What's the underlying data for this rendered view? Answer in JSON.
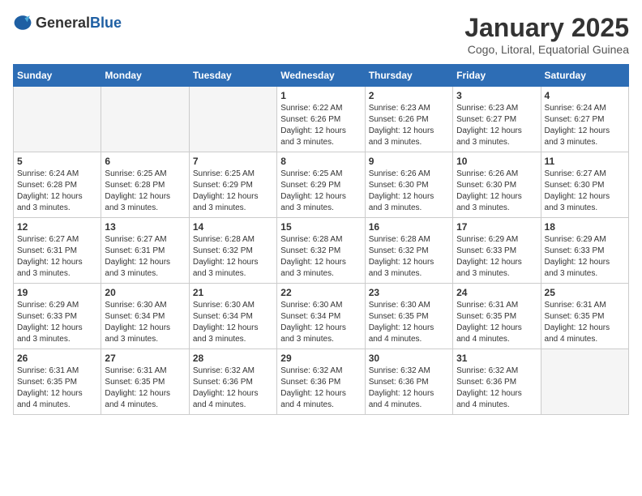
{
  "logo": {
    "general": "General",
    "blue": "Blue"
  },
  "header": {
    "month": "January 2025",
    "location": "Cogo, Litoral, Equatorial Guinea"
  },
  "weekdays": [
    "Sunday",
    "Monday",
    "Tuesday",
    "Wednesday",
    "Thursday",
    "Friday",
    "Saturday"
  ],
  "weeks": [
    [
      {
        "day": "",
        "empty": true
      },
      {
        "day": "",
        "empty": true
      },
      {
        "day": "",
        "empty": true
      },
      {
        "day": "1",
        "sunrise": "6:22 AM",
        "sunset": "6:26 PM",
        "daylight": "12 hours and 3 minutes."
      },
      {
        "day": "2",
        "sunrise": "6:23 AM",
        "sunset": "6:26 PM",
        "daylight": "12 hours and 3 minutes."
      },
      {
        "day": "3",
        "sunrise": "6:23 AM",
        "sunset": "6:27 PM",
        "daylight": "12 hours and 3 minutes."
      },
      {
        "day": "4",
        "sunrise": "6:24 AM",
        "sunset": "6:27 PM",
        "daylight": "12 hours and 3 minutes."
      }
    ],
    [
      {
        "day": "5",
        "sunrise": "6:24 AM",
        "sunset": "6:28 PM",
        "daylight": "12 hours and 3 minutes."
      },
      {
        "day": "6",
        "sunrise": "6:25 AM",
        "sunset": "6:28 PM",
        "daylight": "12 hours and 3 minutes."
      },
      {
        "day": "7",
        "sunrise": "6:25 AM",
        "sunset": "6:29 PM",
        "daylight": "12 hours and 3 minutes."
      },
      {
        "day": "8",
        "sunrise": "6:25 AM",
        "sunset": "6:29 PM",
        "daylight": "12 hours and 3 minutes."
      },
      {
        "day": "9",
        "sunrise": "6:26 AM",
        "sunset": "6:30 PM",
        "daylight": "12 hours and 3 minutes."
      },
      {
        "day": "10",
        "sunrise": "6:26 AM",
        "sunset": "6:30 PM",
        "daylight": "12 hours and 3 minutes."
      },
      {
        "day": "11",
        "sunrise": "6:27 AM",
        "sunset": "6:30 PM",
        "daylight": "12 hours and 3 minutes."
      }
    ],
    [
      {
        "day": "12",
        "sunrise": "6:27 AM",
        "sunset": "6:31 PM",
        "daylight": "12 hours and 3 minutes."
      },
      {
        "day": "13",
        "sunrise": "6:27 AM",
        "sunset": "6:31 PM",
        "daylight": "12 hours and 3 minutes."
      },
      {
        "day": "14",
        "sunrise": "6:28 AM",
        "sunset": "6:32 PM",
        "daylight": "12 hours and 3 minutes."
      },
      {
        "day": "15",
        "sunrise": "6:28 AM",
        "sunset": "6:32 PM",
        "daylight": "12 hours and 3 minutes."
      },
      {
        "day": "16",
        "sunrise": "6:28 AM",
        "sunset": "6:32 PM",
        "daylight": "12 hours and 3 minutes."
      },
      {
        "day": "17",
        "sunrise": "6:29 AM",
        "sunset": "6:33 PM",
        "daylight": "12 hours and 3 minutes."
      },
      {
        "day": "18",
        "sunrise": "6:29 AM",
        "sunset": "6:33 PM",
        "daylight": "12 hours and 3 minutes."
      }
    ],
    [
      {
        "day": "19",
        "sunrise": "6:29 AM",
        "sunset": "6:33 PM",
        "daylight": "12 hours and 3 minutes."
      },
      {
        "day": "20",
        "sunrise": "6:30 AM",
        "sunset": "6:34 PM",
        "daylight": "12 hours and 3 minutes."
      },
      {
        "day": "21",
        "sunrise": "6:30 AM",
        "sunset": "6:34 PM",
        "daylight": "12 hours and 3 minutes."
      },
      {
        "day": "22",
        "sunrise": "6:30 AM",
        "sunset": "6:34 PM",
        "daylight": "12 hours and 3 minutes."
      },
      {
        "day": "23",
        "sunrise": "6:30 AM",
        "sunset": "6:35 PM",
        "daylight": "12 hours and 4 minutes."
      },
      {
        "day": "24",
        "sunrise": "6:31 AM",
        "sunset": "6:35 PM",
        "daylight": "12 hours and 4 minutes."
      },
      {
        "day": "25",
        "sunrise": "6:31 AM",
        "sunset": "6:35 PM",
        "daylight": "12 hours and 4 minutes."
      }
    ],
    [
      {
        "day": "26",
        "sunrise": "6:31 AM",
        "sunset": "6:35 PM",
        "daylight": "12 hours and 4 minutes."
      },
      {
        "day": "27",
        "sunrise": "6:31 AM",
        "sunset": "6:35 PM",
        "daylight": "12 hours and 4 minutes."
      },
      {
        "day": "28",
        "sunrise": "6:32 AM",
        "sunset": "6:36 PM",
        "daylight": "12 hours and 4 minutes."
      },
      {
        "day": "29",
        "sunrise": "6:32 AM",
        "sunset": "6:36 PM",
        "daylight": "12 hours and 4 minutes."
      },
      {
        "day": "30",
        "sunrise": "6:32 AM",
        "sunset": "6:36 PM",
        "daylight": "12 hours and 4 minutes."
      },
      {
        "day": "31",
        "sunrise": "6:32 AM",
        "sunset": "6:36 PM",
        "daylight": "12 hours and 4 minutes."
      },
      {
        "day": "",
        "empty": true
      }
    ]
  ]
}
